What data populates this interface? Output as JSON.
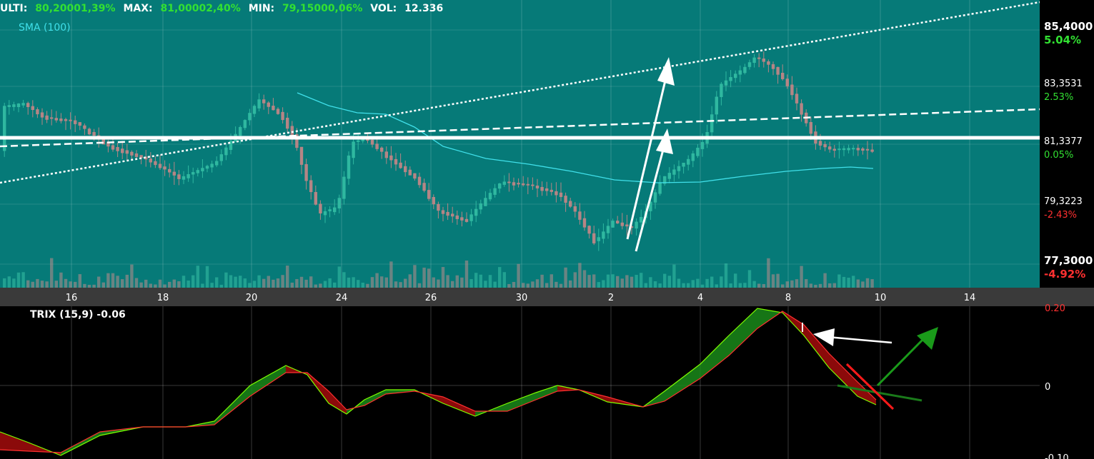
{
  "header": {
    "last_label": "ULTI:",
    "last_value": "80,20001,39%",
    "max_label": "MAX:",
    "max_value": "81,00002,40%",
    "min_label": "MIN:",
    "min_value": "79,15000,06%",
    "vol_label": "VOL:",
    "vol_value": "12.336"
  },
  "sma_label": "SMA (100)",
  "trix_label": "TRIX (15,9) -0.06",
  "price_axis": [
    {
      "price": "85,4000",
      "pct": "5.04%",
      "dir": "up",
      "bold": true
    },
    {
      "price": "83,3531",
      "pct": "2.53%",
      "dir": "up",
      "bold": false
    },
    {
      "price": "81,3377",
      "pct": "0.05%",
      "dir": "up",
      "bold": false
    },
    {
      "price": "79,3223",
      "pct": "-2.43%",
      "dir": "down",
      "bold": false
    },
    {
      "price": "77,3000",
      "pct": "-4.92%",
      "dir": "down",
      "bold": true
    }
  ],
  "date_axis": [
    "16",
    "18",
    "20",
    "24",
    "26",
    "30",
    "2",
    "4",
    "8",
    "10",
    "14"
  ],
  "trix_axis": [
    "0.20",
    "0",
    "-0.10"
  ],
  "colors": {
    "panel_bg": "#067a78",
    "indicator_bg": "#000000",
    "axis_bg": "#3a3a3a",
    "up_candle": "#2fb8a0",
    "down_candle": "#b58585",
    "sma": "#40e0ea",
    "trix_line": "#7fff00",
    "signal_line": "#ff3030",
    "trix_up_fill": "#1a8a1a",
    "trix_down_fill": "#8b0a0a",
    "up_text": "#32e032",
    "down_text": "#ff3030"
  },
  "chart_data": [
    {
      "type": "candlestick",
      "title": "",
      "x": [
        "16",
        "18",
        "20",
        "24",
        "26",
        "30",
        "2",
        "4",
        "8",
        "10",
        "14"
      ],
      "ylim": [
        77.3,
        85.4
      ],
      "series": [
        {
          "name": "SMA (100)",
          "values": [
            83.2,
            82.6,
            82.1,
            81.7,
            81.0,
            80.7,
            80.2,
            80.3,
            80.5,
            80.6
          ]
        }
      ],
      "annotations": [
        "horizontal line at 81.6",
        "rising dotted trend line",
        "dashed trend line",
        "two up arrows",
        "left arrow",
        "down and up arrows on TRIX"
      ]
    },
    {
      "type": "line",
      "title": "",
      "ylim": [
        -0.1,
        0.2
      ],
      "series": [
        {
          "name": "TRIX (15,9) -0.06",
          "values": [
            -0.08,
            -0.1,
            -0.05,
            -0.04,
            -0.04,
            -0.02,
            0.05,
            -0.02,
            0.0,
            -0.02,
            0.0,
            -0.03,
            -0.02,
            0.12,
            0.2,
            0.1,
            -0.06
          ]
        }
      ]
    }
  ]
}
